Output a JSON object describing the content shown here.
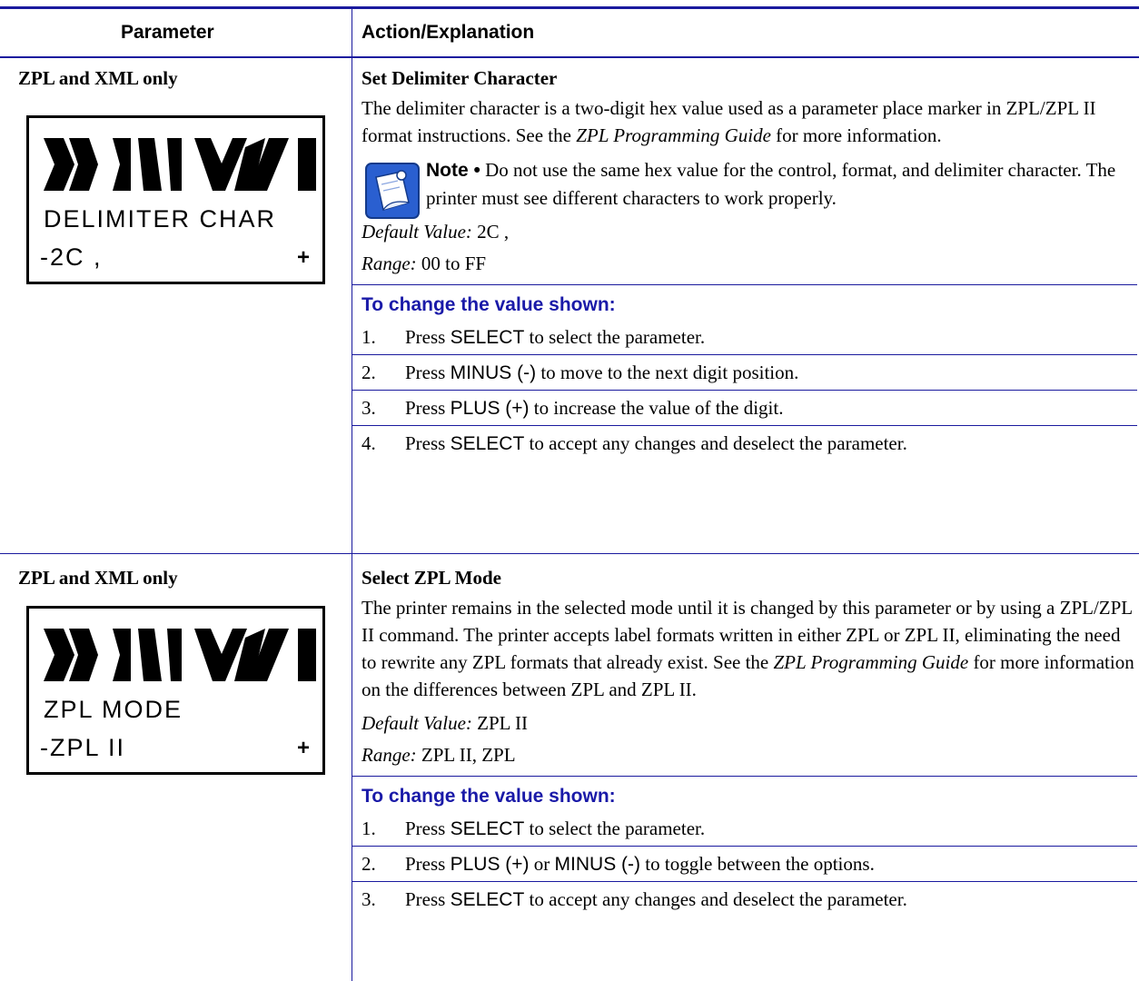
{
  "header": {
    "col1": "Parameter",
    "col2": "Action/Explanation"
  },
  "rows": [
    {
      "param": "ZPL and XML only",
      "lcd": {
        "line1": "DELIMITER CHAR",
        "line2": "-2C ,",
        "plus": "+"
      },
      "title": "Set Delimiter Character",
      "desc_before": "The delimiter character is a two-digit hex value used as a parameter place marker in ZPL/ZPL II format instructions. See the ",
      "desc_italic": "ZPL Programming Guide",
      "desc_after": " for more information.",
      "note_label": "Note •",
      "note_text": " Do not use the same hex value for the control, format, and delimiter character. The printer must see different characters to work properly.",
      "default_label": "Default Value:",
      "default_value": " 2C ,",
      "range_label": "Range:",
      "range_value": " 00 to FF",
      "howto": "To change the value shown:",
      "steps": [
        {
          "n": "1.",
          "pre": "Press ",
          "kw": "SELECT",
          "post": " to select the parameter."
        },
        {
          "n": "2.",
          "pre": "Press ",
          "kw": "MINUS (-)",
          "post": " to move to the next digit position."
        },
        {
          "n": "3.",
          "pre": "Press ",
          "kw": "PLUS (+)",
          "post": " to increase the value of the digit."
        },
        {
          "n": "4.",
          "pre": "Press ",
          "kw": "SELECT",
          "post": " to accept any changes and deselect the parameter."
        }
      ]
    },
    {
      "param": "ZPL and XML only",
      "lcd": {
        "line1": "ZPL MODE",
        "line2": "-ZPL II",
        "plus": "+"
      },
      "title": "Select ZPL Mode",
      "desc_before": "The printer remains in the selected mode until it is changed by this parameter or by using a ZPL/ZPL II command. The printer accepts label formats written in either ZPL or ZPL II, eliminating the need to rewrite any ZPL formats that already exist. See the ",
      "desc_italic": "ZPL Programming Guide",
      "desc_after": " for more information on the differences between ZPL and ZPL II.",
      "default_label": "Default Value:",
      "default_value": " ZPL II",
      "range_label": "Range:",
      "range_value": " ZPL II, ZPL",
      "howto": "To change the value shown:",
      "steps": [
        {
          "n": "1.",
          "pre": "Press ",
          "kw": "SELECT",
          "post": " to select the parameter."
        },
        {
          "n": "2.",
          "pre": "Press ",
          "kw": "PLUS (+)",
          "mid": " or ",
          "kw2": "MINUS (-)",
          "post": " to toggle between the options."
        },
        {
          "n": "3.",
          "pre": "Press ",
          "kw": "SELECT",
          "post": " to accept any changes and deselect the parameter."
        }
      ]
    }
  ],
  "icons": {
    "logo": "zebra-stripes-logo",
    "note": "note-pad-icon"
  },
  "colors": {
    "rule": "#1a1a9e",
    "howto": "#1a1aa8"
  }
}
